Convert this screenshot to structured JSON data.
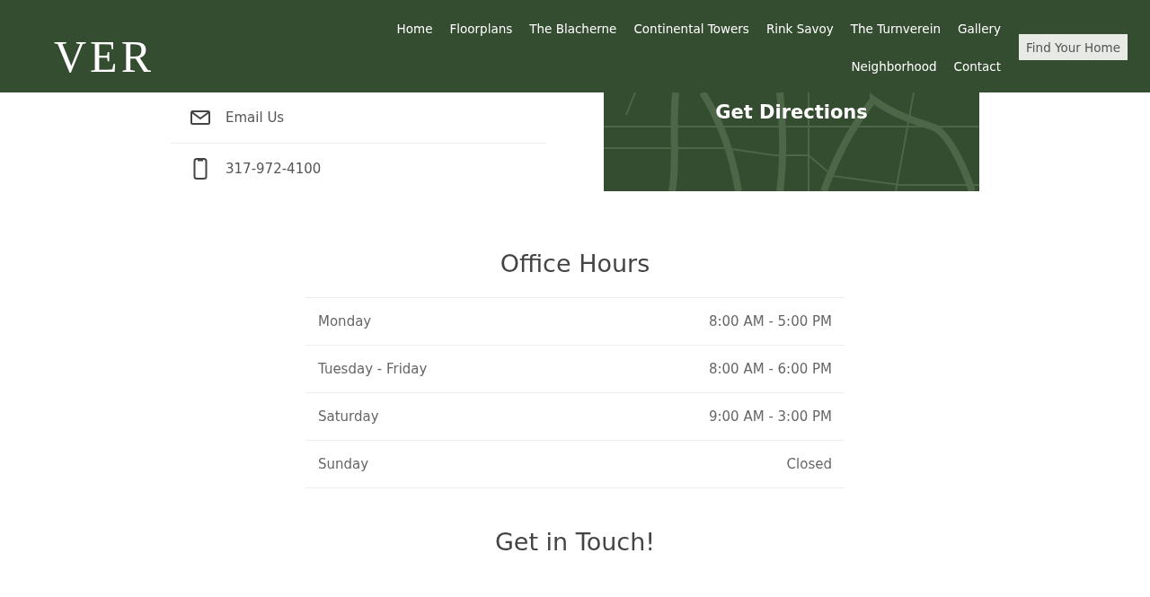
{
  "header": {
    "logo": "VER",
    "nav": [
      {
        "label": "Home"
      },
      {
        "label": "Floorplans"
      },
      {
        "label": "The Blacherne"
      },
      {
        "label": "Continental Towers"
      },
      {
        "label": "Rink Savoy"
      },
      {
        "label": "The Turnverein"
      },
      {
        "label": "Gallery"
      },
      {
        "label": "Neighborhood"
      },
      {
        "label": "Contact"
      }
    ],
    "cta": "Find Your Home"
  },
  "contact": [
    {
      "kind": "email",
      "label": "Email Us"
    },
    {
      "kind": "phone",
      "label": "317-972-4100"
    }
  ],
  "map_card": {
    "kind": "picture",
    "title": "Get Directions"
  },
  "office_hours": {
    "title": "Office Hours",
    "rows": [
      {
        "day": "Monday",
        "hours": "8:00 AM - 5:00 PM"
      },
      {
        "day": "Tuesday - Friday",
        "hours": "8:00 AM - 6:00 PM"
      },
      {
        "day": "Saturday",
        "hours": "9:00 AM - 3:00 PM"
      },
      {
        "day": "Sunday",
        "hours": "Closed"
      }
    ]
  },
  "get_in_touch": {
    "title": "Get in Touch!"
  }
}
